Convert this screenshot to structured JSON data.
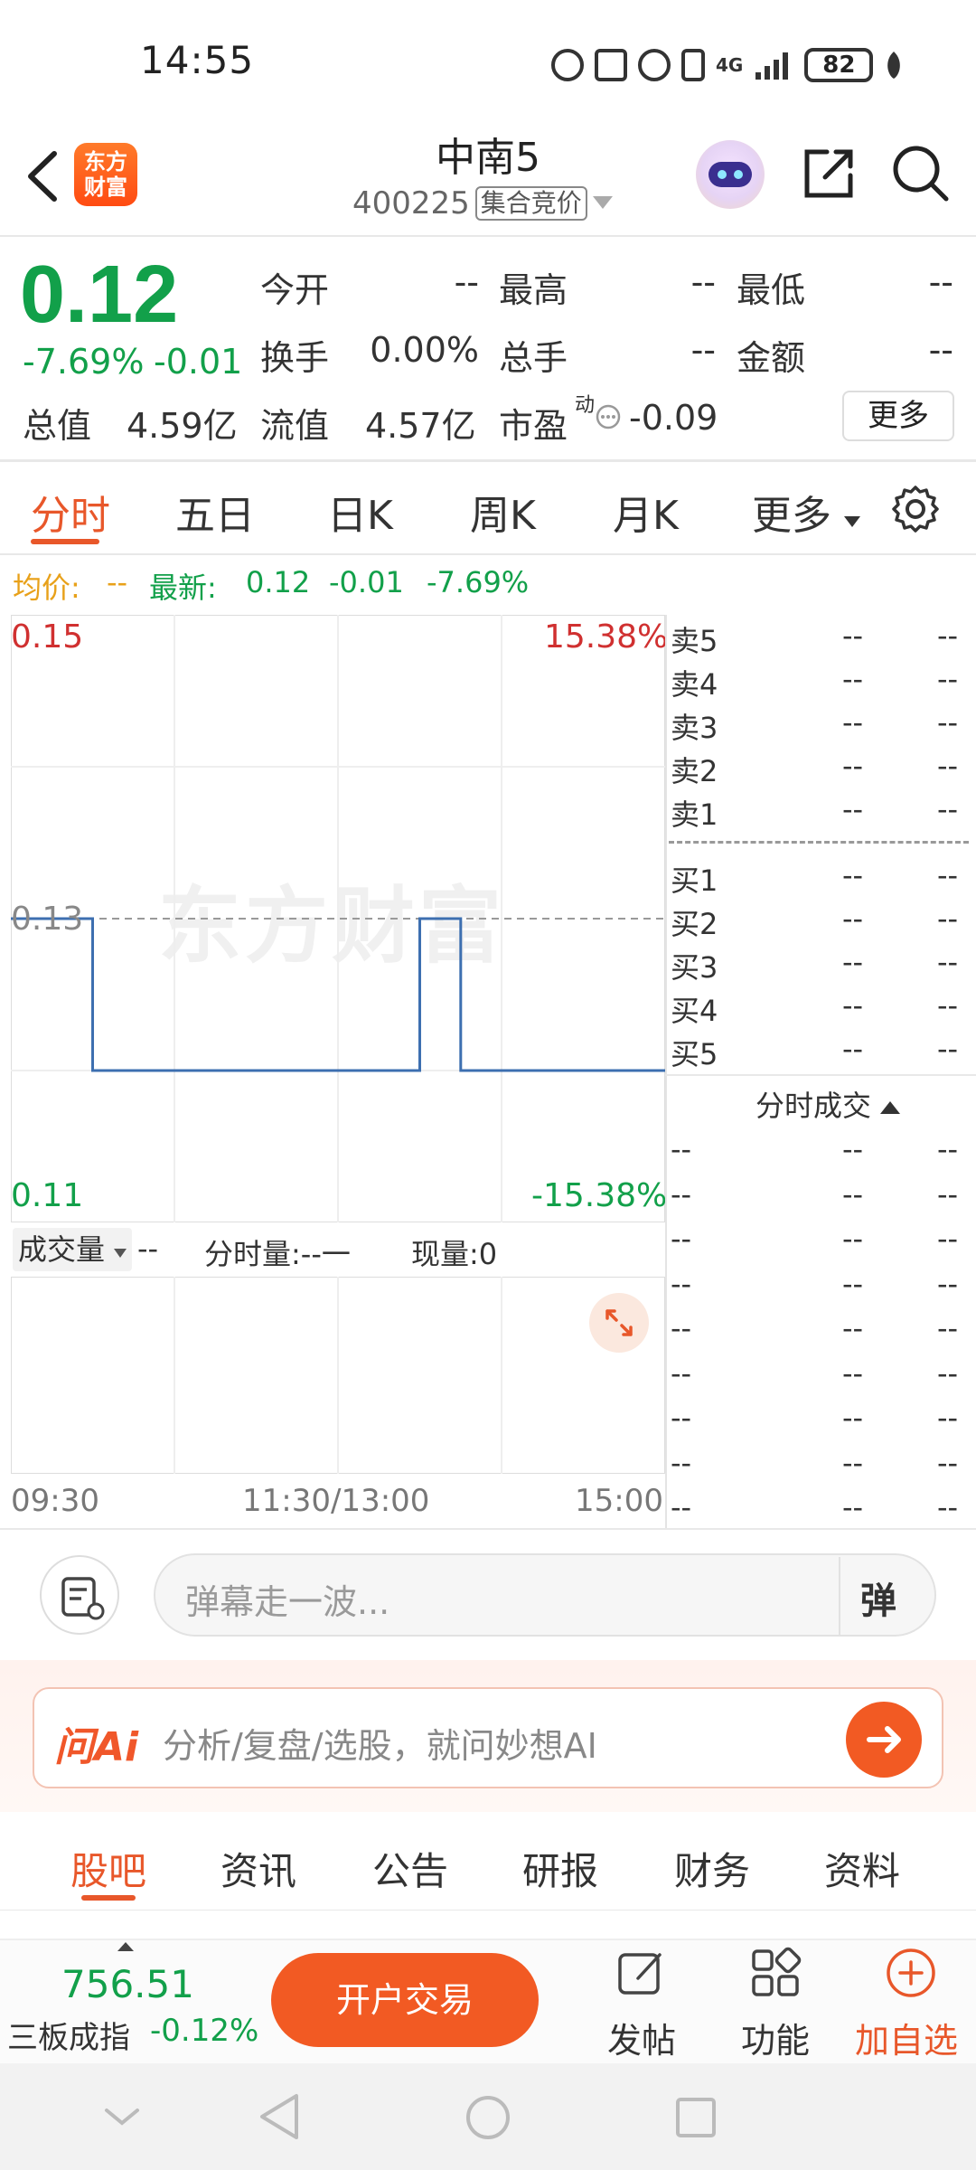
{
  "status_bar": {
    "time": "14:55",
    "battery": "82",
    "network": "4G",
    "icons": [
      "nfc-icon",
      "n-icon",
      "alarm-icon",
      "vibrate-icon",
      "signal-icon",
      "battery-icon",
      "leaf-icon"
    ]
  },
  "header": {
    "logo_line1": "东方",
    "logo_line2": "财富",
    "stock_name": "中南5",
    "stock_code": "400225",
    "auction_tag": "集合竞价"
  },
  "quote": {
    "price": "0.12",
    "change_pct": "-7.69%",
    "change_amt": "-0.01",
    "open_label": "今开",
    "open_value": "--",
    "high_label": "最高",
    "high_value": "--",
    "low_label": "最低",
    "low_value": "--",
    "turnover_label": "换手",
    "turnover_value": "0.00%",
    "total_hands_label": "总手",
    "total_hands_value": "--",
    "amount_label": "金额",
    "amount_value": "--",
    "market_cap_label": "总值",
    "market_cap_value": "4.59亿",
    "float_cap_label": "流值",
    "float_cap_value": "4.57亿",
    "pe_label": "市盈",
    "pe_superscript": "动",
    "pe_value": "-0.09",
    "more_button": "更多"
  },
  "chart_tabs": [
    "分时",
    "五日",
    "日K",
    "周K",
    "月K",
    "更多"
  ],
  "info_line": {
    "avg_label": "均价:",
    "avg_value": "--",
    "latest_label": "最新:",
    "latest_value": "0.12",
    "latest_chg": "-0.01",
    "latest_pct": "-7.69%"
  },
  "chart_data": {
    "type": "line",
    "x": [
      "09:30",
      "10:00",
      "10:00",
      "13:30",
      "13:30",
      "13:45",
      "13:45",
      "15:00"
    ],
    "series": [
      {
        "values": [
          0.13,
          0.13,
          0.12,
          0.12,
          0.13,
          0.13,
          0.12,
          0.12
        ]
      }
    ],
    "ylim": [
      0.11,
      0.15
    ],
    "y_labels": {
      "max": "0.15",
      "mid": "0.13",
      "min": "0.11"
    },
    "pct_labels": {
      "max": "15.38%",
      "min": "-15.38%"
    },
    "x_tick_labels": [
      "09:30",
      "11:30/13:00",
      "15:00"
    ],
    "reference_price": 0.13,
    "watermark": "东方财富",
    "grid": true
  },
  "volume": {
    "select_label": "成交量",
    "value": "--",
    "fenshi_label": "分时量:--一",
    "now_label": "现量:0"
  },
  "order_book": {
    "sell": [
      {
        "label": "卖5",
        "price": "--",
        "vol": "--"
      },
      {
        "label": "卖4",
        "price": "--",
        "vol": "--"
      },
      {
        "label": "卖3",
        "price": "--",
        "vol": "--"
      },
      {
        "label": "卖2",
        "price": "--",
        "vol": "--"
      },
      {
        "label": "卖1",
        "price": "--",
        "vol": "--"
      }
    ],
    "buy": [
      {
        "label": "买1",
        "price": "--",
        "vol": "--"
      },
      {
        "label": "买2",
        "price": "--",
        "vol": "--"
      },
      {
        "label": "买3",
        "price": "--",
        "vol": "--"
      },
      {
        "label": "买4",
        "price": "--",
        "vol": "--"
      },
      {
        "label": "买5",
        "price": "--",
        "vol": "--"
      }
    ]
  },
  "trades": {
    "header": "分时成交",
    "rows": [
      [
        "--",
        "--",
        "--"
      ],
      [
        "--",
        "--",
        "--"
      ],
      [
        "--",
        "--",
        "--"
      ],
      [
        "--",
        "--",
        "--"
      ],
      [
        "--",
        "--",
        "--"
      ],
      [
        "--",
        "--",
        "--"
      ],
      [
        "--",
        "--",
        "--"
      ],
      [
        "--",
        "--",
        "--"
      ],
      [
        "--",
        "--",
        "--"
      ]
    ]
  },
  "danmaku": {
    "placeholder": "弹幕走一波...",
    "button": "弹"
  },
  "ai": {
    "logo": "问Ai",
    "placeholder": "分析/复盘/选股，就问妙想AI"
  },
  "bottom_tabs": [
    "股吧",
    "资讯",
    "公告",
    "研报",
    "财务",
    "资料"
  ],
  "toolbar": {
    "index_value": "756.51",
    "index_name": "三板成指",
    "index_change": "-0.12%",
    "trade_button": "开户交易",
    "post_label": "发帖",
    "func_label": "功能",
    "add_watch_label": "加自选"
  },
  "colors": {
    "accent": "#e8572a",
    "up": "#d03030",
    "down": "#12a04a",
    "line": "#3d6fb0"
  }
}
